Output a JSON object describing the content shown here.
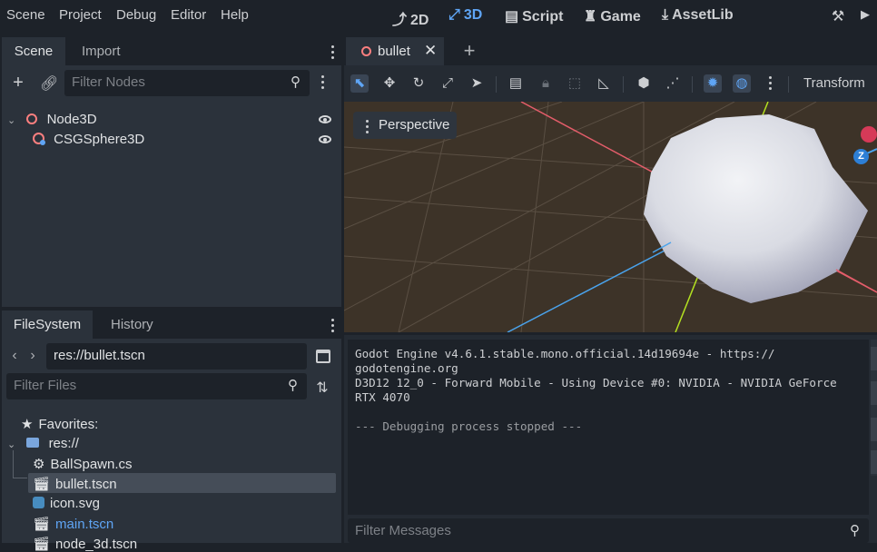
{
  "menu": {
    "items": [
      "Scene",
      "Project",
      "Debug",
      "Editor",
      "Help"
    ],
    "workspaces": [
      {
        "label": "2D",
        "icon": "2d-icon"
      },
      {
        "label": "3D",
        "icon": "3d-icon"
      },
      {
        "label": "Script",
        "icon": "script-icon"
      },
      {
        "label": "Game",
        "icon": "game-icon"
      },
      {
        "label": "AssetLib",
        "icon": "assetlib-icon"
      }
    ],
    "active_workspace": "3D"
  },
  "scene_dock": {
    "tabs": [
      "Scene",
      "Import"
    ],
    "filter_placeholder": "Filter Nodes",
    "nodes": [
      {
        "label": "Node3D",
        "icon": "node3d-icon"
      },
      {
        "label": "CSGSphere3D",
        "icon": "csgsphere-icon"
      }
    ]
  },
  "filesystem_dock": {
    "tabs": [
      "FileSystem",
      "History"
    ],
    "path": "res://bullet.tscn",
    "filter_placeholder": "Filter Files",
    "favorites_label": "Favorites:",
    "root_label": "res://",
    "files": [
      {
        "label": "BallSpawn.cs",
        "icon": "gear-icon"
      },
      {
        "label": "bullet.tscn",
        "icon": "clapper-icon",
        "selected": true
      },
      {
        "label": "icon.svg",
        "icon": "godot-icon"
      },
      {
        "label": "main.tscn",
        "icon": "clapper-icon",
        "highlight": true
      },
      {
        "label": "node_3d.tscn",
        "icon": "clapper-icon"
      }
    ]
  },
  "editor": {
    "tab_label": "bullet",
    "perspective_label": "Perspective",
    "transform_label": "Transform",
    "gizmo_z_label": "Z"
  },
  "output": {
    "lines": [
      "Godot Engine v4.6.1.stable.mono.official.14d19694e - https://",
      "godotengine.org",
      "D3D12 12_0 - Forward Mobile - Using Device #0: NVIDIA - NVIDIA GeForce",
      "RTX 4070",
      "",
      "--- Debugging process stopped ---"
    ],
    "filter_placeholder": "Filter Messages"
  },
  "colors": {
    "accent": "#5fa5f5",
    "node_red": "#fc7f7f",
    "highlight_file": "#5fa5f5"
  }
}
